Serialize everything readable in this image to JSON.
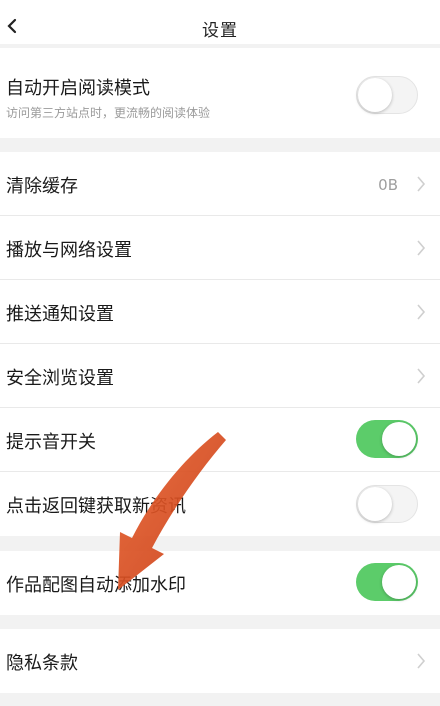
{
  "header": {
    "title": "设置"
  },
  "settings": {
    "reading_mode": {
      "label": "自动开启阅读模式",
      "sublabel": "访问第三方站点时，更流畅的阅读体验",
      "enabled": false
    },
    "clear_cache": {
      "label": "清除缓存",
      "value": "0B"
    },
    "playback_network": {
      "label": "播放与网络设置"
    },
    "push_notification": {
      "label": "推送通知设置"
    },
    "safe_browsing": {
      "label": "安全浏览设置"
    },
    "sound_toggle": {
      "label": "提示音开关",
      "enabled": true
    },
    "back_refresh": {
      "label": "点击返回键获取新资讯",
      "enabled": false
    },
    "watermark": {
      "label": "作品配图自动添加水印",
      "enabled": true
    },
    "privacy": {
      "label": "隐私条款"
    }
  },
  "colors": {
    "toggle_on": "#5ccc6a",
    "arrow": "#d8461c"
  }
}
